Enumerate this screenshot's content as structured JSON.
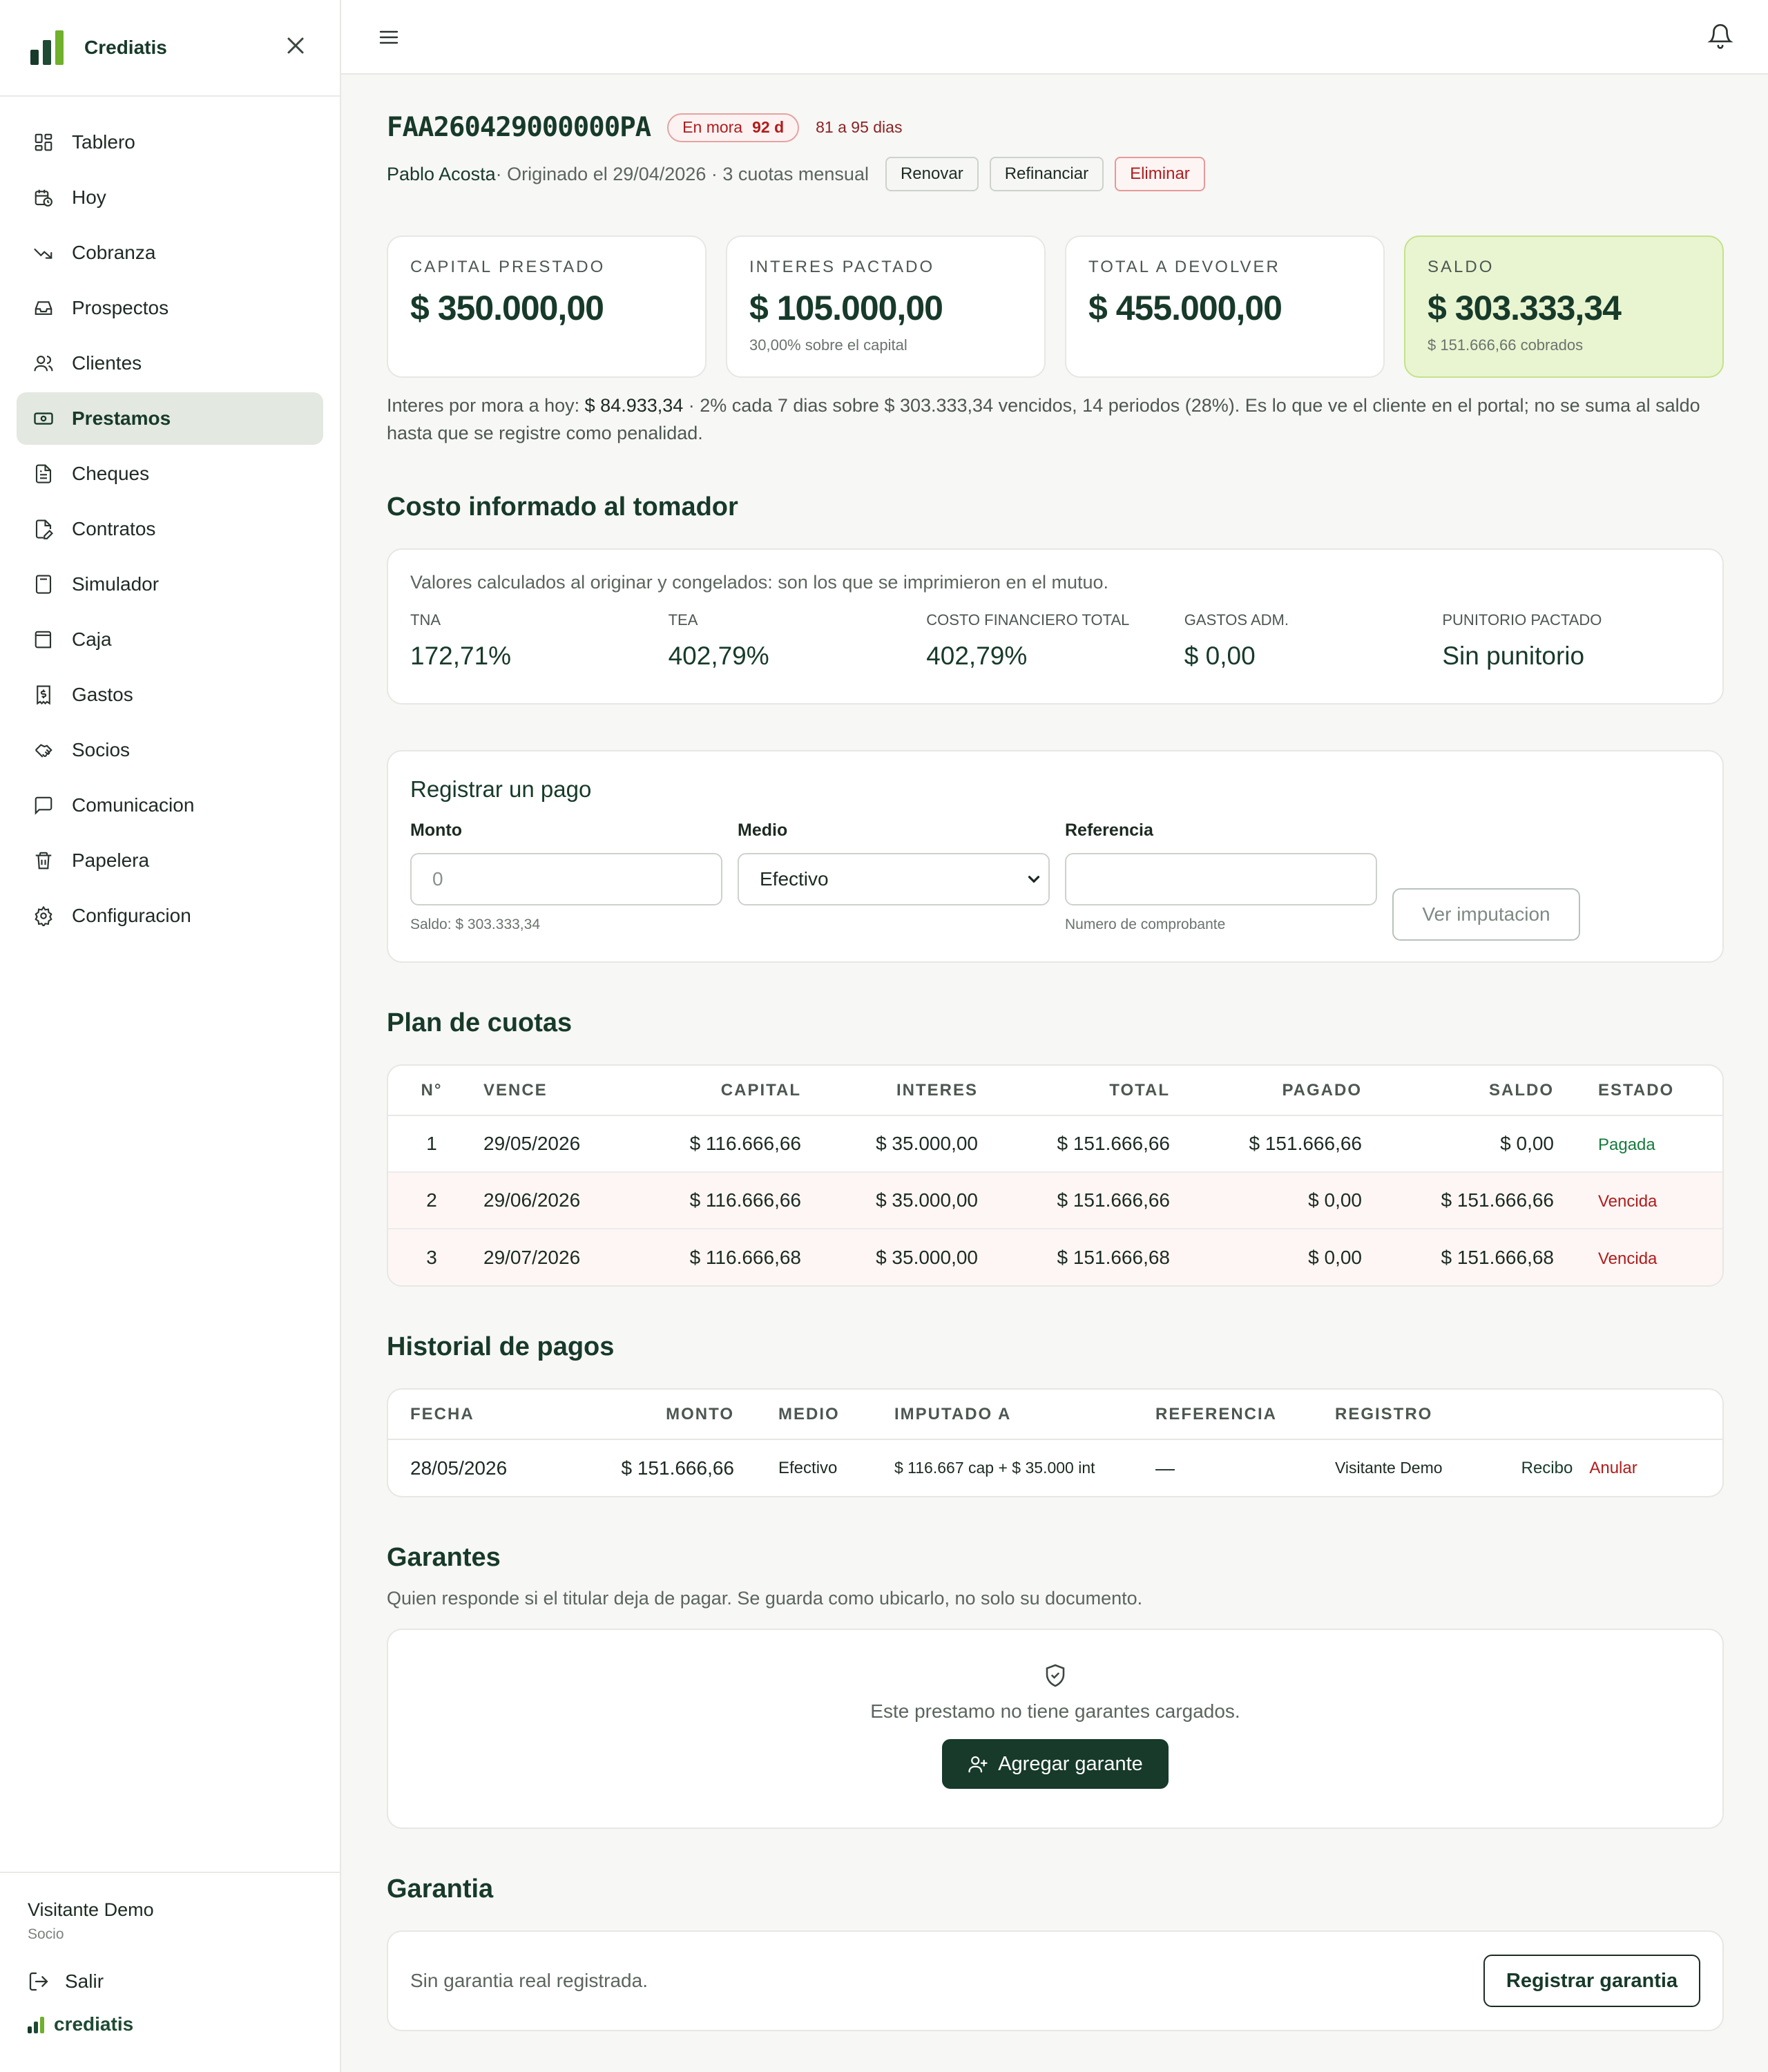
{
  "sidebar": {
    "brand": "Crediatis",
    "items": [
      {
        "label": "Tablero",
        "icon": "dashboard-icon"
      },
      {
        "label": "Hoy",
        "icon": "calendar-clock-icon"
      },
      {
        "label": "Cobranza",
        "icon": "trending-down-icon"
      },
      {
        "label": "Prospectos",
        "icon": "inbox-icon"
      },
      {
        "label": "Clientes",
        "icon": "users-icon"
      },
      {
        "label": "Prestamos",
        "icon": "banknote-icon"
      },
      {
        "label": "Cheques",
        "icon": "file-text-icon"
      },
      {
        "label": "Contratos",
        "icon": "file-edit-icon"
      },
      {
        "label": "Simulador",
        "icon": "calculator-icon"
      },
      {
        "label": "Caja",
        "icon": "wallet-icon"
      },
      {
        "label": "Gastos",
        "icon": "receipt-icon"
      },
      {
        "label": "Socios",
        "icon": "handshake-icon"
      },
      {
        "label": "Comunicacion",
        "icon": "message-icon"
      },
      {
        "label": "Papelera",
        "icon": "trash-icon"
      },
      {
        "label": "Configuracion",
        "icon": "settings-icon"
      }
    ],
    "active": "Prestamos",
    "user": {
      "name": "Visitante Demo",
      "role": "Socio"
    },
    "logout": "Salir",
    "foot_brand": "crediatis"
  },
  "loan": {
    "id": "FAA260429000000PA",
    "status": "En mora",
    "days": "92 d",
    "range": "81 a 95 dias",
    "client": "Pablo Acosta",
    "meta": " · Originado el 29/04/2026 · 3 cuotas mensual",
    "actions": {
      "renew": "Renovar",
      "refinance": "Refinanciar",
      "delete": "Eliminar"
    }
  },
  "stats": [
    {
      "label": "CAPITAL PRESTADO",
      "value": "$ 350.000,00",
      "sub": ""
    },
    {
      "label": "INTERES PACTADO",
      "value": "$ 105.000,00",
      "sub": "30,00% sobre el capital"
    },
    {
      "label": "TOTAL A DEVOLVER",
      "value": "$ 455.000,00",
      "sub": ""
    },
    {
      "label": "SALDO",
      "value": "$ 303.333,34",
      "sub": "$ 151.666,66 cobrados"
    }
  ],
  "mora_note": {
    "prefix": "Interes por mora a hoy: ",
    "amount": "$ 84.933,34",
    "text": " · 2% cada 7 dias sobre $ 303.333,34 vencidos, 14 periodos (28%). Es lo que ve el cliente en el portal; no se suma al saldo hasta que se registre como penalidad."
  },
  "cost": {
    "title": "Costo informado al tomador",
    "note": "Valores calculados al originar y congelados: son los que se imprimieron en el mutuo.",
    "items": [
      {
        "label": "TNA",
        "value": "172,71%"
      },
      {
        "label": "TEA",
        "value": "402,79%"
      },
      {
        "label": "COSTO FINANCIERO TOTAL",
        "value": "402,79%"
      },
      {
        "label": "GASTOS ADM.",
        "value": "$ 0,00"
      },
      {
        "label": "PUNITORIO PACTADO",
        "value": "Sin punitorio"
      }
    ]
  },
  "payment": {
    "title": "Registrar un pago",
    "amount_label": "Monto",
    "amount_placeholder": "0",
    "amount_hint": "Saldo: $ 303.333,34",
    "method_label": "Medio",
    "method_value": "Efectivo",
    "ref_label": "Referencia",
    "ref_value": "",
    "ref_hint": "Numero de comprobante",
    "preview_button": "Ver imputacion"
  },
  "plan": {
    "title": "Plan de cuotas",
    "headers": [
      "N°",
      "VENCE",
      "CAPITAL",
      "INTERES",
      "TOTAL",
      "PAGADO",
      "SALDO",
      "ESTADO"
    ],
    "rows": [
      {
        "n": "1",
        "due": "29/05/2026",
        "capital": "$ 116.666,66",
        "interest": "$ 35.000,00",
        "total": "$ 151.666,66",
        "paid": "$ 151.666,66",
        "balance": "$ 0,00",
        "status": "Pagada"
      },
      {
        "n": "2",
        "due": "29/06/2026",
        "capital": "$ 116.666,66",
        "interest": "$ 35.000,00",
        "total": "$ 151.666,66",
        "paid": "$ 0,00",
        "balance": "$ 151.666,66",
        "status": "Vencida"
      },
      {
        "n": "3",
        "due": "29/07/2026",
        "capital": "$ 116.666,68",
        "interest": "$ 35.000,00",
        "total": "$ 151.666,68",
        "paid": "$ 0,00",
        "balance": "$ 151.666,68",
        "status": "Vencida"
      }
    ]
  },
  "history": {
    "title": "Historial de pagos",
    "headers": [
      "FECHA",
      "MONTO",
      "MEDIO",
      "IMPUTADO A",
      "REFERENCIA",
      "REGISTRO"
    ],
    "rows": [
      {
        "date": "28/05/2026",
        "amount": "$ 151.666,66",
        "method": "Efectivo",
        "applied": "$ 116.667 cap + $ 35.000 int",
        "reference": "—",
        "registered_by": "Visitante Demo",
        "receipt": "Recibo",
        "void": "Anular"
      }
    ]
  },
  "guarantors": {
    "title": "Garantes",
    "subtitle": "Quien responde si el titular deja de pagar. Se guarda como ubicarlo, no solo su documento.",
    "empty": "Este prestamo no tiene garantes cargados.",
    "add_button": "Agregar garante"
  },
  "collateral": {
    "title": "Garantia",
    "empty": "Sin garantia real registrada.",
    "button": "Registrar garantia"
  },
  "colors": {
    "primary": "#173a2a",
    "accent": "#e9f5d1",
    "danger": "#b01c1c",
    "success": "#177a3c"
  }
}
